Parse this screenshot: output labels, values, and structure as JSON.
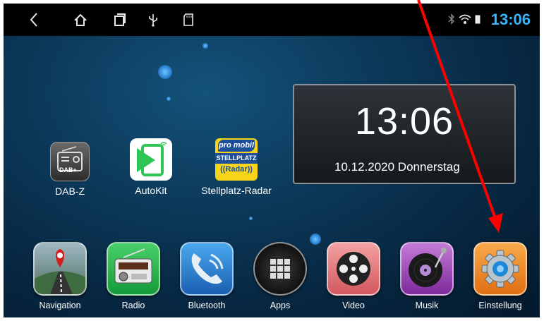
{
  "status": {
    "time": "13:06",
    "icons": [
      "back-icon",
      "home-icon",
      "recents-icon",
      "usb-icon",
      "sd-card-icon",
      "bluetooth-icon",
      "wifi-icon",
      "battery-icon"
    ]
  },
  "clock": {
    "time": "13:06",
    "date": "10.12.2020  Donnerstag"
  },
  "apps": [
    {
      "label": "DAB-Z",
      "icon": "radio-dab-icon"
    },
    {
      "label": "AutoKit",
      "icon": "autokit-icon"
    },
    {
      "label": "Stellplatz-Radar",
      "icon": "stellplatz-radar-icon"
    }
  ],
  "stellplatz_logo": {
    "top": "pro mobil",
    "mid": "STELLPLATZ",
    "bottom": "((Radar))"
  },
  "dab_badge": "DAB+",
  "dock": [
    {
      "label": "Navigation",
      "icon": "navigation-icon"
    },
    {
      "label": "Radio",
      "icon": "radio-icon"
    },
    {
      "label": "Bluetooth",
      "icon": "phone-icon"
    },
    {
      "label": "Apps",
      "icon": "apps-grid-icon"
    },
    {
      "label": "Video",
      "icon": "film-reel-icon"
    },
    {
      "label": "Musik",
      "icon": "music-turntable-icon"
    },
    {
      "label": "Einstellung",
      "icon": "settings-gear-icon"
    }
  ],
  "colors": {
    "accent": "#35b7ff",
    "annotation_arrow": "#ff0000"
  }
}
